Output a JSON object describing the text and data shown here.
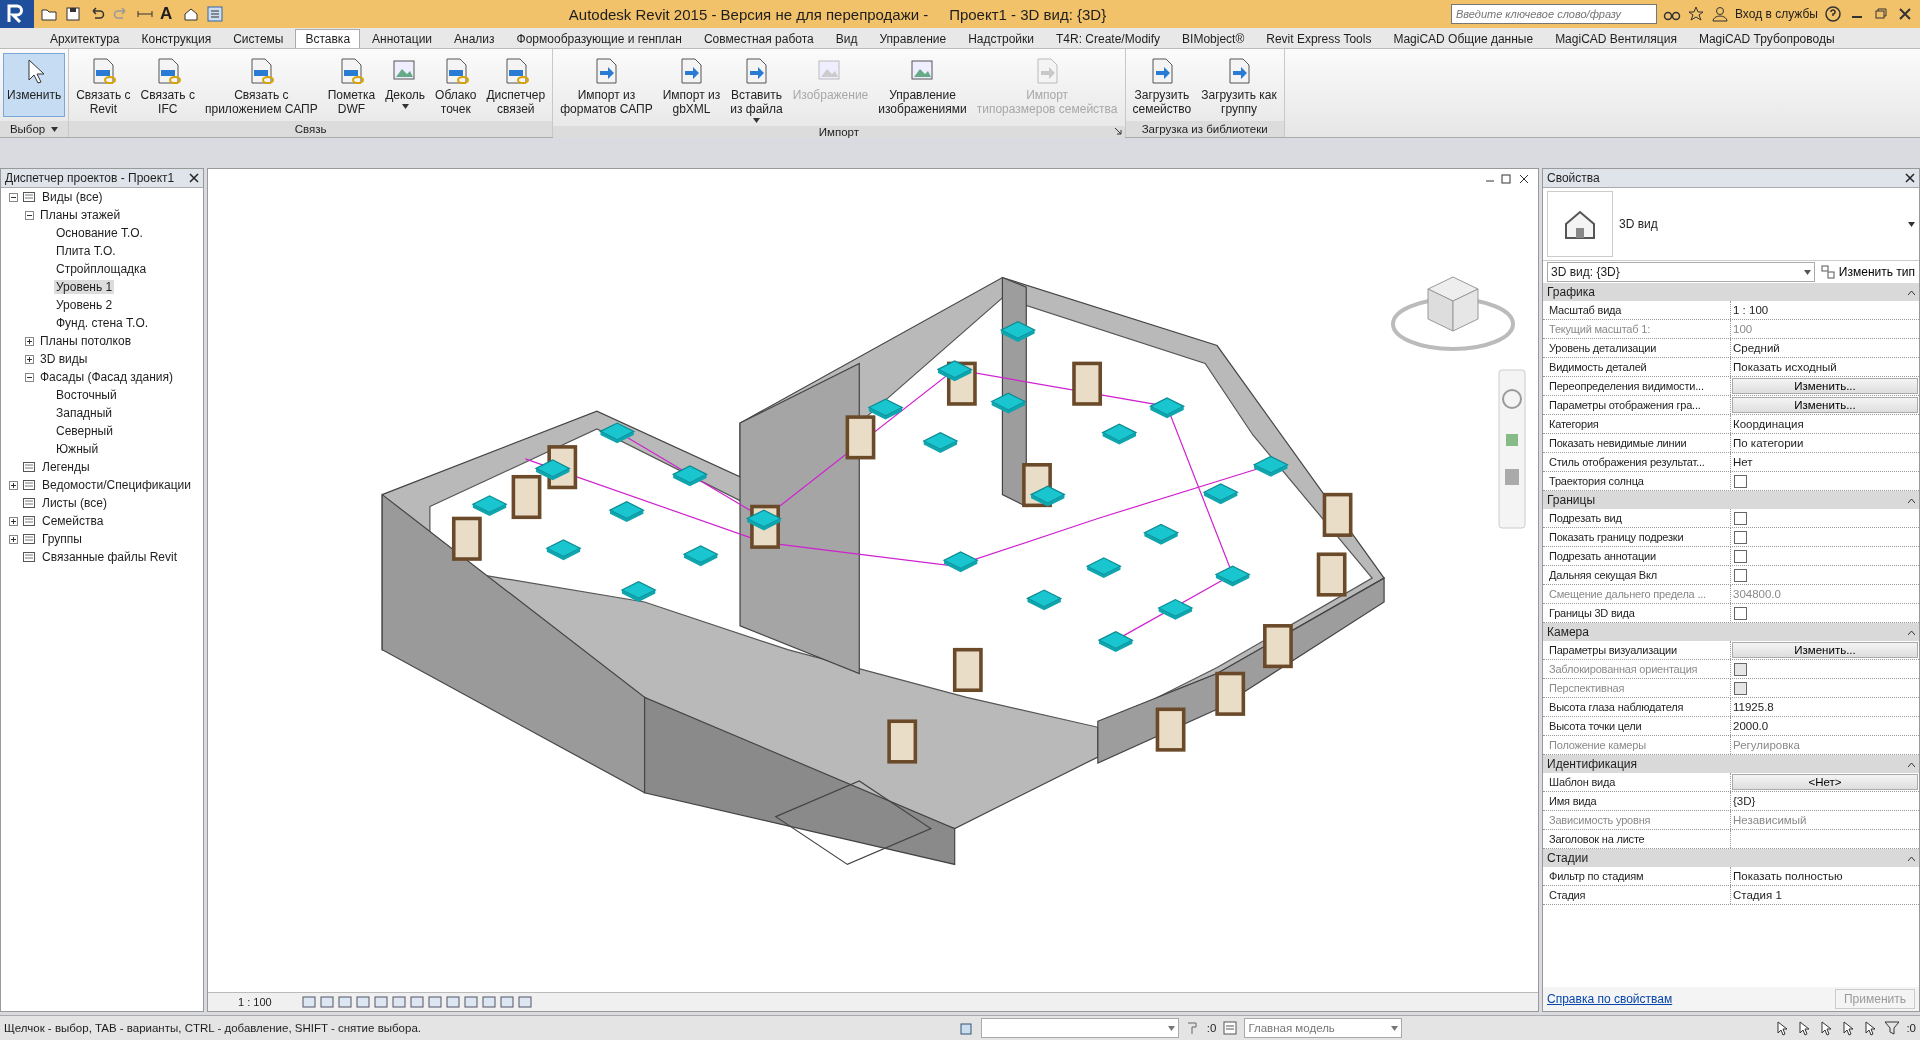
{
  "title_bar": {
    "text_tool_glyph": "A",
    "title": "Autodesk Revit 2015 - Версия не для перепродажи -     Проект1 - 3D вид: {3D}",
    "search_placeholder": "Введите ключевое слово/фразу",
    "sign_in": "Вход в службы"
  },
  "ribbon_tabs": [
    {
      "label": "Архитектура",
      "selected": false
    },
    {
      "label": "Конструкция",
      "selected": false
    },
    {
      "label": "Системы",
      "selected": false
    },
    {
      "label": "Вставка",
      "selected": true
    },
    {
      "label": "Аннотации",
      "selected": false
    },
    {
      "label": "Анализ",
      "selected": false
    },
    {
      "label": "Формообразующие и генплан",
      "selected": false
    },
    {
      "label": "Совместная работа",
      "selected": false
    },
    {
      "label": "Вид",
      "selected": false
    },
    {
      "label": "Управление",
      "selected": false
    },
    {
      "label": "Надстройки",
      "selected": false
    },
    {
      "label": "T4R: Create/Modify",
      "selected": false
    },
    {
      "label": "BIMobject®",
      "selected": false
    },
    {
      "label": "Revit Express Tools",
      "selected": false
    },
    {
      "label": "MagiCAD Общие данные",
      "selected": false
    },
    {
      "label": "MagiCAD Вентиляция",
      "selected": false
    },
    {
      "label": "MagiCAD Трубопроводы",
      "selected": false
    }
  ],
  "ribbon_panels": [
    {
      "title": "Выбор",
      "dropdown": true,
      "launcher": false,
      "buttons": [
        {
          "kind": "select",
          "label": "Изменить",
          "disabled": false,
          "dropdown": false
        }
      ]
    },
    {
      "title": "Связь",
      "dropdown": false,
      "launcher": false,
      "buttons": [
        {
          "kind": "link",
          "label": "Связать с\nRevit",
          "disabled": false,
          "dropdown": false
        },
        {
          "kind": "link",
          "label": "Связать с\nIFC",
          "disabled": false,
          "dropdown": false
        },
        {
          "kind": "link",
          "label": "Связать с\nприложением САПР",
          "disabled": false,
          "dropdown": false
        },
        {
          "kind": "link",
          "label": "Пометка\nDWF",
          "disabled": false,
          "dropdown": false
        },
        {
          "kind": "image",
          "label": "Деколь",
          "disabled": false,
          "dropdown": true
        },
        {
          "kind": "link",
          "label": "Облако\nточек",
          "disabled": false,
          "dropdown": false
        },
        {
          "kind": "link",
          "label": "Диспетчер\nсвязей",
          "disabled": false,
          "dropdown": false
        }
      ]
    },
    {
      "title": "Импорт",
      "dropdown": false,
      "launcher": true,
      "buttons": [
        {
          "kind": "import",
          "label": "Импорт из\nформатов САПР",
          "disabled": false,
          "dropdown": false
        },
        {
          "kind": "import",
          "label": "Импорт из\ngbXML",
          "disabled": false,
          "dropdown": false
        },
        {
          "kind": "import",
          "label": "Вставить\nиз файла",
          "disabled": false,
          "dropdown": true
        },
        {
          "kind": "image",
          "label": "Изображение",
          "disabled": true,
          "dropdown": false
        },
        {
          "kind": "image",
          "label": "Управление\nизображениями",
          "disabled": false,
          "dropdown": false
        },
        {
          "kind": "import",
          "label": "Импорт\nтипоразмеров семейства",
          "disabled": true,
          "dropdown": false
        }
      ]
    },
    {
      "title": "Загрузка из библиотеки",
      "dropdown": false,
      "launcher": false,
      "buttons": [
        {
          "kind": "import",
          "label": "Загрузить\nсемейство",
          "disabled": false,
          "dropdown": false
        },
        {
          "kind": "import",
          "label": "Загрузить как\nгруппу",
          "disabled": false,
          "dropdown": false
        }
      ]
    }
  ],
  "project_browser": {
    "title": "Диспетчер проектов - Проект1",
    "tree": [
      {
        "label": "Виды (все)",
        "expanded": true,
        "selected": false,
        "children": [
          {
            "label": "Планы этажей",
            "expanded": true,
            "selected": false,
            "children": [
              {
                "label": "Основание Т.О.",
                "selected": false
              },
              {
                "label": "Плита Т.О.",
                "selected": false
              },
              {
                "label": "Стройплощадка",
                "selected": false
              },
              {
                "label": "Уровень 1",
                "selected": true
              },
              {
                "label": "Уровень 2",
                "selected": false
              },
              {
                "label": "Фунд. стена Т.О.",
                "selected": false
              }
            ]
          },
          {
            "label": "Планы потолков",
            "expanded": false,
            "selected": false
          },
          {
            "label": "3D виды",
            "expanded": false,
            "selected": false
          },
          {
            "label": "Фасады (Фасад здания)",
            "expanded": true,
            "selected": false,
            "children": [
              {
                "label": "Восточный",
                "selected": false
              },
              {
                "label": "Западный",
                "selected": false
              },
              {
                "label": "Северный",
                "selected": false
              },
              {
                "label": "Южный",
                "selected": false
              }
            ]
          }
        ]
      },
      {
        "label": "Легенды",
        "selected": false
      },
      {
        "label": "Ведомости/Спецификации",
        "expanded": false,
        "selected": false
      },
      {
        "label": "Листы (все)",
        "selected": false
      },
      {
        "label": "Семейства",
        "expanded": false,
        "selected": false
      },
      {
        "label": "Группы",
        "expanded": false,
        "selected": false
      },
      {
        "label": "Связанные файлы Revit",
        "selected": false
      }
    ]
  },
  "viewport": {
    "scale": "1 : 100"
  },
  "properties": {
    "title": "Свойства",
    "type_name": "3D вид",
    "type_selector": "3D вид: {3D}",
    "edit_type": "Изменить тип",
    "groups": [
      {
        "title": "Графика",
        "rows": [
          {
            "kind": "text",
            "label": "Масштаб вида",
            "value": "1 : 100",
            "disabled": false
          },
          {
            "kind": "text",
            "label": "Текущий масштаб    1:",
            "value": "100",
            "disabled": true
          },
          {
            "kind": "text",
            "label": "Уровень детализации",
            "value": "Средний",
            "disabled": false
          },
          {
            "kind": "text",
            "label": "Видимость деталей",
            "value": "Показать исходный",
            "disabled": false
          },
          {
            "kind": "button",
            "label": "Переопределения видимости...",
            "value": "Изменить...",
            "disabled": false
          },
          {
            "kind": "button",
            "label": "Параметры отображения гра...",
            "value": "Изменить...",
            "disabled": false
          },
          {
            "kind": "text",
            "label": "Категория",
            "value": "Координация",
            "disabled": false
          },
          {
            "kind": "text",
            "label": "Показать невидимые линии",
            "value": "По категории",
            "disabled": false
          },
          {
            "kind": "text",
            "label": "Стиль отображения результат...",
            "value": "Нет",
            "disabled": false
          },
          {
            "kind": "checkbox",
            "label": "Траектория солнца",
            "checked": false,
            "disabled": false
          }
        ]
      },
      {
        "title": "Границы",
        "rows": [
          {
            "kind": "checkbox",
            "label": "Подрезать вид",
            "checked": false,
            "disabled": false
          },
          {
            "kind": "checkbox",
            "label": "Показать границу подрезки",
            "checked": false,
            "disabled": false
          },
          {
            "kind": "checkbox",
            "label": "Подрезать аннотации",
            "checked": false,
            "disabled": false
          },
          {
            "kind": "checkbox",
            "label": "Дальняя секущая Вкл",
            "checked": false,
            "disabled": false
          },
          {
            "kind": "text",
            "label": "Смещение дальнего предела ...",
            "value": "304800.0",
            "disabled": true
          },
          {
            "kind": "checkbox",
            "label": "Границы 3D вида",
            "checked": false,
            "disabled": false
          }
        ]
      },
      {
        "title": "Камера",
        "rows": [
          {
            "kind": "button",
            "label": "Параметры визуализации",
            "value": "Изменить...",
            "disabled": false
          },
          {
            "kind": "checkbox",
            "label": "Заблокированная ориентация",
            "checked": false,
            "disabled": true
          },
          {
            "kind": "checkbox",
            "label": "Перспективная",
            "checked": false,
            "disabled": true
          },
          {
            "kind": "text",
            "label": "Высота глаза наблюдателя",
            "value": "11925.8",
            "disabled": false
          },
          {
            "kind": "text",
            "label": "Высота точки цели",
            "value": "2000.0",
            "disabled": false
          },
          {
            "kind": "text",
            "label": "Положение камеры",
            "value": "Регулировка",
            "disabled": true
          }
        ]
      },
      {
        "title": "Идентификация",
        "rows": [
          {
            "kind": "button",
            "label": "Шаблон вида",
            "value": "<Нет>",
            "disabled": false
          },
          {
            "kind": "text",
            "label": "Имя вида",
            "value": "{3D}",
            "disabled": false
          },
          {
            "kind": "text",
            "label": "Зависимость уровня",
            "value": "Независимый",
            "disabled": true
          },
          {
            "kind": "text",
            "label": "Заголовок на листе",
            "disabled": false
          }
        ]
      },
      {
        "title": "Стадии",
        "rows": [
          {
            "kind": "text",
            "label": "Фильтр по стадиям",
            "value": "Показать полностью",
            "disabled": false
          },
          {
            "kind": "text",
            "label": "Стадия",
            "value": "Стадия 1",
            "disabled": false
          }
        ]
      }
    ],
    "help_link": "Справка по свойствам",
    "apply": {
      "label": "Применить",
      "disabled": true
    }
  },
  "status_bar": {
    "hint": "Щелчок - выбор, TAB - варианты, CTRL - добавление, SHIFT - снятие выбора.",
    "design_option_count": ":0",
    "workset": "Главная модель",
    "filter_count": ":0"
  }
}
